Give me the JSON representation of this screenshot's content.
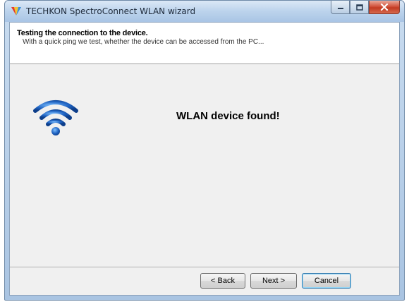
{
  "window": {
    "title": "TECHKON SpectroConnect WLAN wizard"
  },
  "header": {
    "title": "Testing the connection to the device.",
    "subtitle": "With a quick ping we test, whether the device can be accessed from the PC..."
  },
  "main": {
    "status_icon": "wifi-icon",
    "status_message": "WLAN device found!"
  },
  "buttons": {
    "back": "< Back",
    "next": "Next >",
    "cancel": "Cancel"
  },
  "colors": {
    "accent": "#1f63c2",
    "close_button": "#c9432b"
  }
}
